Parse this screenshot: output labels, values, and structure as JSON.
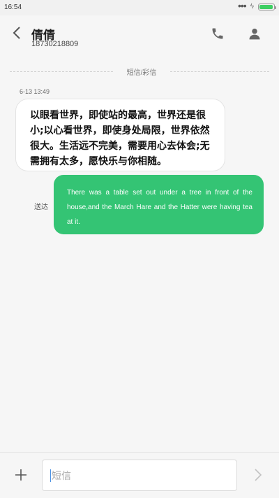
{
  "statusbar": {
    "time": "16:54",
    "battery_level": 0.95
  },
  "header": {
    "contact_name": "倩倩",
    "contact_number": "18730218809",
    "icons": {
      "back": "back-arrow-icon",
      "call": "phone-icon",
      "contact": "person-icon"
    }
  },
  "thread": {
    "divider_label": "短信/彩信",
    "timestamp": "6-13 13:49",
    "messages": [
      {
        "direction": "incoming",
        "text": "以眼看世界，即使站的最高，世界还是很小;以心看世界，即使身处局限，世界依然很大。生活远不完美，需要用心去体会;无需拥有太多，愿快乐与你相随。"
      },
      {
        "direction": "outgoing",
        "text": "There was a table set out under a tree in front of the house,and the March Hare and the Hatter were having tea at it.",
        "status": "送达"
      }
    ]
  },
  "composer": {
    "placeholder": "短信",
    "icons": {
      "add": "plus-icon",
      "send": "send-arrow-icon"
    }
  },
  "colors": {
    "outgoing_bubble": "#34c474",
    "incoming_bubble": "#ffffff",
    "battery": "#3ecf63",
    "background": "#f6f6f6"
  }
}
